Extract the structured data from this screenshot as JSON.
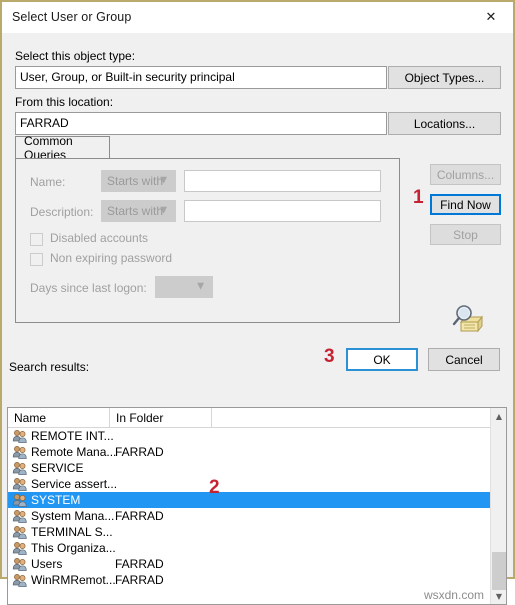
{
  "window": {
    "title": "Select User or Group",
    "close_icon": "close-icon",
    "border_color": "#b9a96a"
  },
  "object_type": {
    "label": "Select this object type:",
    "value": "User, Group, or Built-in security principal",
    "button": "Object Types..."
  },
  "location": {
    "label": "From this location:",
    "value": "FARRAD",
    "button": "Locations..."
  },
  "tabs": [
    {
      "label": "Common Queries",
      "selected": true
    }
  ],
  "query": {
    "name_label": "Name:",
    "name_operator": "Starts with",
    "name_value": "",
    "description_label": "Description:",
    "description_operator": "Starts with",
    "description_value": "",
    "disabled_accounts_label": "Disabled accounts",
    "disabled_accounts_checked": false,
    "non_expiring_password_label": "Non expiring password",
    "non_expiring_password_checked": false,
    "days_since_logon_label": "Days since last logon:",
    "days_since_logon_value": ""
  },
  "side_buttons": {
    "columns": "Columns...",
    "find_now": "Find Now",
    "stop": "Stop",
    "find_icon": "magnifier-folder-icon"
  },
  "dialog_buttons": {
    "ok": "OK",
    "cancel": "Cancel"
  },
  "results": {
    "label": "Search results:",
    "columns": [
      "Name",
      "In Folder"
    ],
    "rows": [
      {
        "name": "REMOTE INT...",
        "folder": "",
        "selected": false
      },
      {
        "name": "Remote Mana...",
        "folder": "FARRAD",
        "selected": false
      },
      {
        "name": "SERVICE",
        "folder": "",
        "selected": false
      },
      {
        "name": "Service assert...",
        "folder": "",
        "selected": false
      },
      {
        "name": "SYSTEM",
        "folder": "",
        "selected": true
      },
      {
        "name": "System Mana...",
        "folder": "FARRAD",
        "selected": false
      },
      {
        "name": "TERMINAL S...",
        "folder": "",
        "selected": false
      },
      {
        "name": "This Organiza...",
        "folder": "",
        "selected": false
      },
      {
        "name": "Users",
        "folder": "FARRAD",
        "selected": false
      },
      {
        "name": "WinRMRemot...",
        "folder": "FARRAD",
        "selected": false
      }
    ],
    "scrollbar": {
      "up_icon": "chevron-up-icon",
      "down_icon": "chevron-down-icon"
    }
  },
  "annotations": [
    {
      "id": "step-1",
      "text": "1",
      "color": "#c52233"
    },
    {
      "id": "step-2",
      "text": "2",
      "color": "#c52233"
    },
    {
      "id": "step-3",
      "text": "3",
      "color": "#c52233"
    }
  ],
  "watermark": "wsxdn.com"
}
